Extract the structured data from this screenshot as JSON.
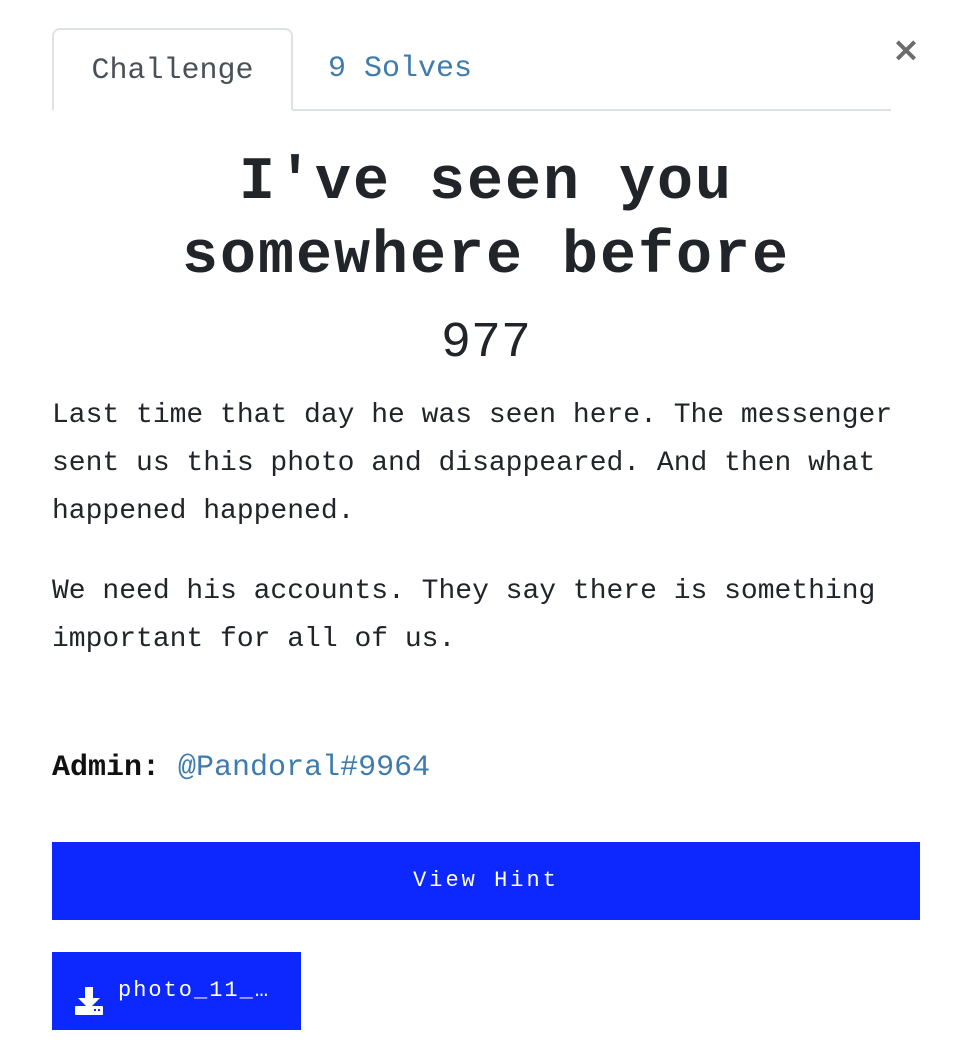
{
  "tabs": {
    "challenge_label": "Challenge",
    "solves_label": "9 Solves"
  },
  "close_icon": "close-icon",
  "challenge": {
    "title": "I've seen you somewhere before",
    "points": "977",
    "description": [
      "Last time that day he was seen here. The messenger sent us this photo and disappeared. And then what happened happened.",
      "We need his accounts. They say there is something important for all of us."
    ],
    "admin_label": "Admin:",
    "admin_handle": "@Pandoral#9964"
  },
  "buttons": {
    "view_hint_label": "View Hint",
    "file_label": "photo_11_…"
  },
  "icons": {
    "download": "download-icon"
  },
  "colors": {
    "accent": "#0d27ff",
    "link": "#3f7cad"
  }
}
